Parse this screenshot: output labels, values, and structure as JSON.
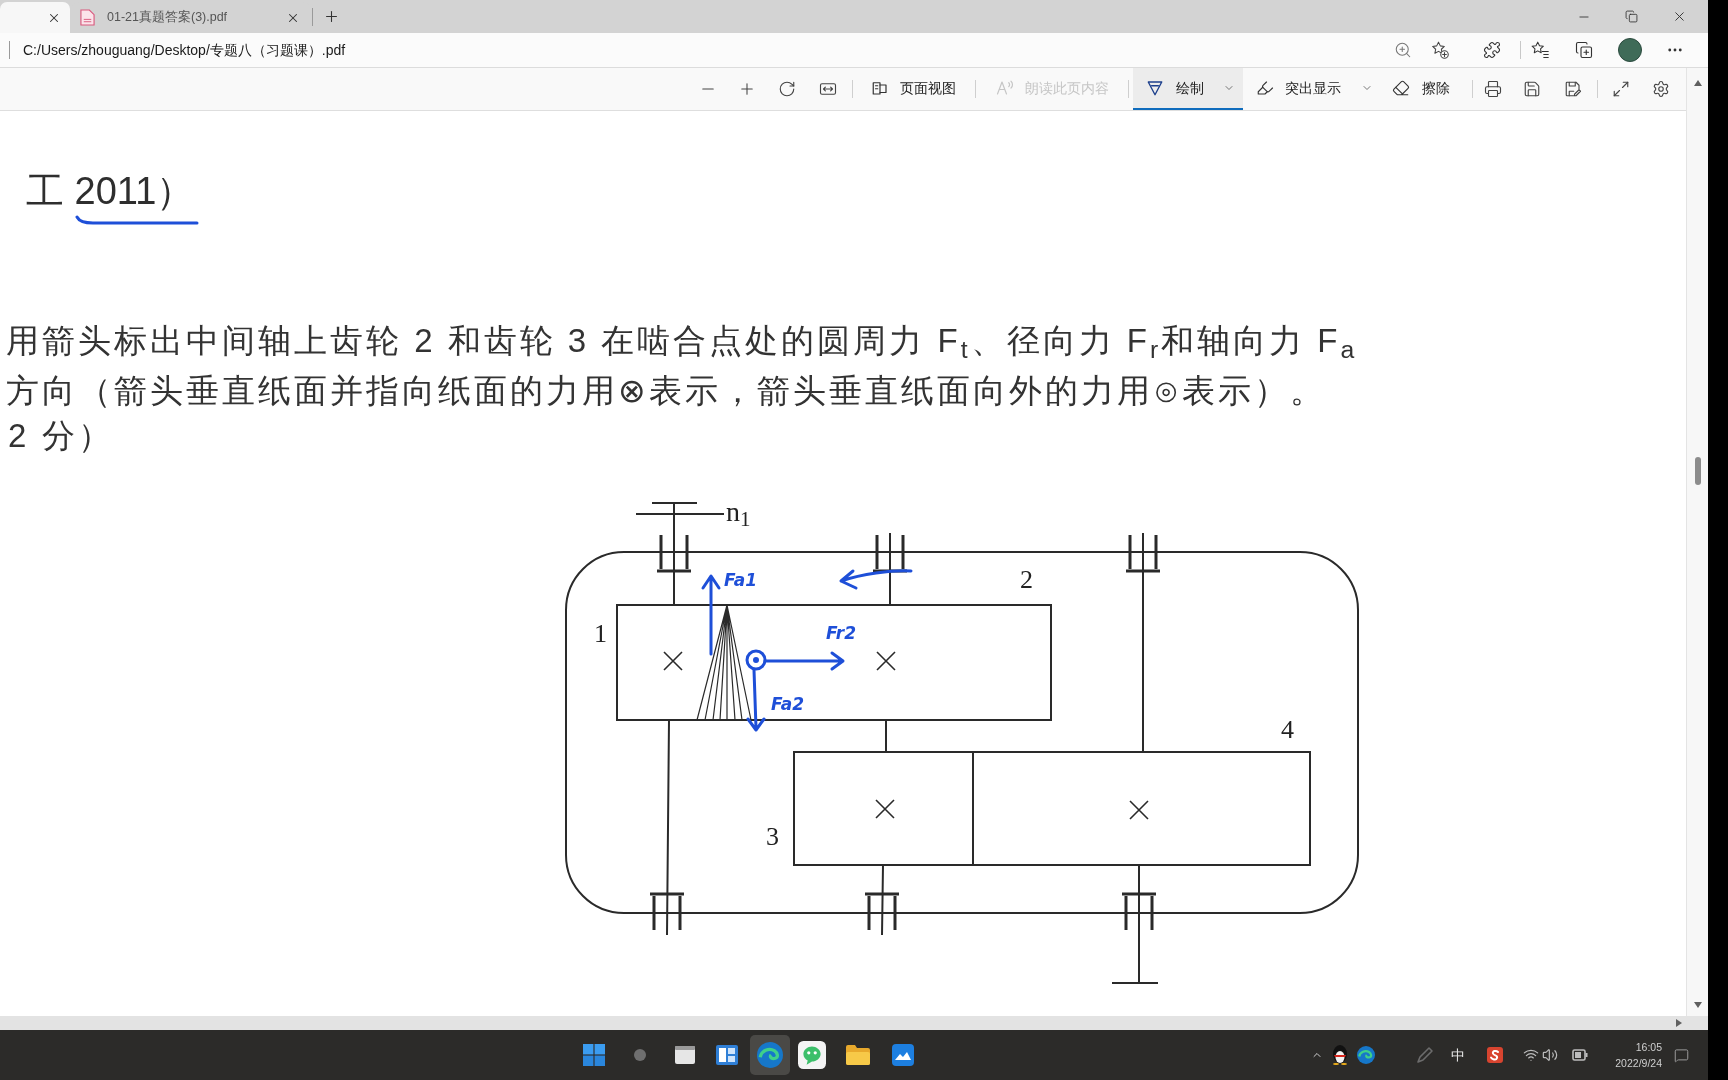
{
  "browser": {
    "tabs": [
      {
        "selected": true
      },
      {
        "title": "01-21真题答案(3).pdf",
        "selected": false
      }
    ],
    "address": "C:/Users/zhouguang/Desktop/专题八（习题课）.pdf"
  },
  "pdf_toolbar": {
    "tools": [
      {
        "kind": "button",
        "label": "页面视图",
        "selected": false,
        "disabled": false
      },
      {
        "kind": "button",
        "label": "朗读此页内容",
        "selected": false,
        "disabled": true
      },
      {
        "kind": "dropdown",
        "label": "绘制",
        "selected": true,
        "disabled": false
      },
      {
        "kind": "dropdown",
        "label": "突出显示",
        "selected": false,
        "disabled": false
      },
      {
        "kind": "button",
        "label": "擦除",
        "selected": false,
        "disabled": false
      }
    ]
  },
  "document": {
    "heading": "工 2011）",
    "question": "用箭头标出中间轴上齿轮 2 和齿轮 3 在啮合点处的圆周力 F$_{t}$、径向力 F$_{r}$和轴向力 F$_{a}$\n方向（箭头垂直纸面并指向纸面的力用⊗表示，箭头垂直纸面向外的力用⊙表示）。",
    "score": "2 分）",
    "diagram": {
      "speed_label": "n$_{1}$",
      "gear_labels": [
        "1",
        "2",
        "3",
        "4"
      ],
      "ink_labels": [
        "Fa1",
        "Fr2",
        "Fa2"
      ]
    }
  },
  "taskbar": {
    "apps": [
      {
        "selected": false
      },
      {
        "selected": false
      },
      {
        "selected": false
      },
      {
        "selected": false
      },
      {
        "selected": true
      },
      {
        "selected": false
      },
      {
        "selected": false
      },
      {
        "selected": false
      }
    ],
    "input_method": "中",
    "clock": {
      "time": "16:05",
      "date": "2022/9/24"
    }
  }
}
